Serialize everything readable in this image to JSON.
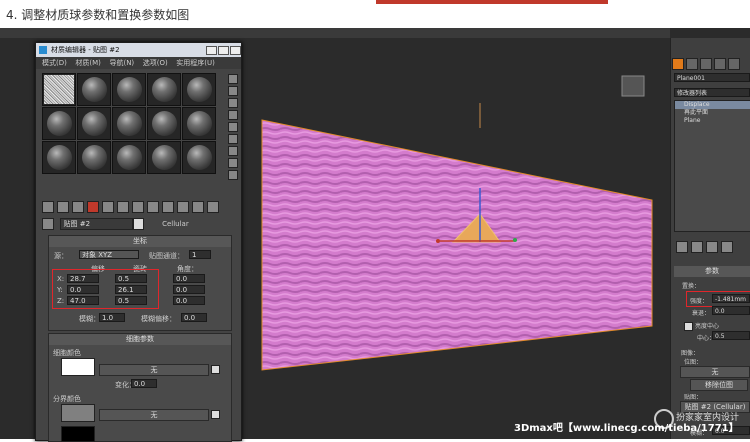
{
  "caption": "4. 调整材质球参数和置换参数如图",
  "material_editor": {
    "title": "材质编辑器 - 贴图 #2",
    "menu": [
      "模式(D)",
      "材质(M)",
      "导航(N)",
      "选项(O)",
      "实用程序(U)"
    ],
    "map_name": "贴图 #2",
    "map_type": "Cellular",
    "coordinates": {
      "header": "坐标",
      "source_label": "源：",
      "source_value": "对象 XYZ",
      "map_channel_label": "贴图通道：",
      "map_channel_value": "1",
      "offset_label": "偏移",
      "tiling_label": "瓷砖",
      "angle_label": "角度：",
      "rows": [
        {
          "axis": "X:",
          "offset": "28.7",
          "tiling": "0.5",
          "angle": "0.0"
        },
        {
          "axis": "Y:",
          "offset": "0.0",
          "tiling": "26.1",
          "angle": "0.0"
        },
        {
          "axis": "Z:",
          "offset": "47.0",
          "tiling": "0.5",
          "angle": "0.0"
        }
      ],
      "blur_label": "模糊：",
      "blur_value": "1.0",
      "blur_offset_label": "模糊偏移：",
      "blur_offset_value": "0.0"
    },
    "cell_params": {
      "header": "细胞参数",
      "cell_color_label": "细胞颜色",
      "none_label": "无",
      "variation_label": "变化：",
      "variation_value": "0.0",
      "division_color_label": "分界颜色",
      "none_label_2": "无"
    }
  },
  "command_panel": {
    "object_name": "Plane001",
    "modifier_list": "修改器列表",
    "stack": [
      "Displace",
      "再此平面",
      "Plane"
    ],
    "params_header": "参数",
    "displace_label": "置换：",
    "strength_label": "强度：",
    "strength_value": "-1.481mm",
    "decay_label": "衰退：",
    "decay_value": "0.0",
    "luminance_center_label": "亮度中心",
    "center_label": "中心：",
    "center_value": "0.5",
    "image_label": "图像：",
    "bitmap_label": "位图：",
    "none_label": "无",
    "remove_bitmap": "移除位图",
    "map_label": "贴图：",
    "map_value": "贴图 #2 (Cellular)",
    "blur_label": "模糊：",
    "blur_value": "0.0"
  },
  "watermark": {
    "text": "3Dmax吧【www.linecg.com/tieba/1771】",
    "right_text": "扮家家室内设计"
  }
}
